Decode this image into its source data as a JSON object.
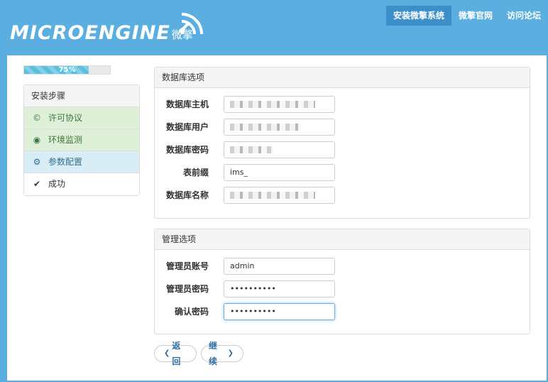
{
  "header": {
    "logo_text": "MICROENGINE",
    "logo_cn": "微擎",
    "nav": [
      {
        "label": "安装微擎系统",
        "active": true
      },
      {
        "label": "微擎官网",
        "active": false
      },
      {
        "label": "访问论坛",
        "active": false
      }
    ]
  },
  "progress": {
    "label": "75%",
    "value": 0.75
  },
  "steps": {
    "title": "安装步骤",
    "items": [
      {
        "label": "许可协议",
        "icon": "copyright-icon",
        "state": "done"
      },
      {
        "label": "环境监测",
        "icon": "eye-icon",
        "state": "done"
      },
      {
        "label": "参数配置",
        "icon": "gear-icon",
        "state": "current"
      },
      {
        "label": "成功",
        "icon": "check-icon",
        "state": "pending"
      }
    ]
  },
  "db_panel": {
    "title": "数据库选项",
    "fields": [
      {
        "label": "数据库主机",
        "value": ""
      },
      {
        "label": "数据库用户",
        "value": ""
      },
      {
        "label": "数据库密码",
        "value": ""
      },
      {
        "label": "表前缀",
        "value": "ims_"
      },
      {
        "label": "数据库名称",
        "value": ""
      }
    ]
  },
  "admin_panel": {
    "title": "管理选项",
    "fields": [
      {
        "label": "管理员账号",
        "value": "admin"
      },
      {
        "label": "管理员密码",
        "value": "••••••••••"
      },
      {
        "label": "确认密码",
        "value": "••••••••••"
      }
    ]
  },
  "buttons": {
    "back": "返回",
    "next": "继续"
  },
  "colors": {
    "header_bg": "#5aafe0",
    "nav_active": "#3d8fc9",
    "step_done": "#dff0d8",
    "step_current": "#d9edf7"
  }
}
